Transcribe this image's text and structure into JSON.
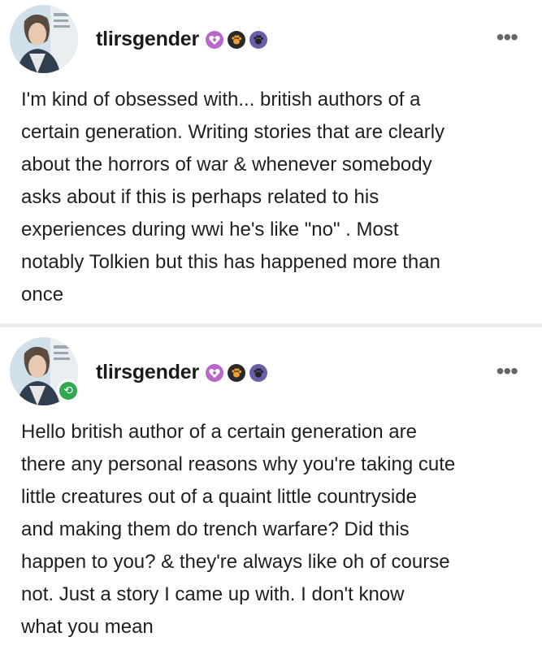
{
  "posts": [
    {
      "username": "tlirsgender",
      "more_icon": "more-horizontal-icon",
      "badges": [
        "sparkle-heart-badge-icon",
        "paw-badge-icon",
        "paw-badge-icon"
      ],
      "lines": [
        "I'm kind of obsessed with... british authors of a",
        "certain generation. Writing stories that are clearly",
        "about the horrors of war & whenever somebody",
        "asks about if this is perhaps related to his",
        "experiences during wwi he's like \"no\" . Most",
        "notably Tolkien but this has happened more than",
        "once"
      ]
    },
    {
      "username": "tlirsgender",
      "more_icon": "more-horizontal-icon",
      "reblog_icon": "reblog-icon",
      "badges": [
        "sparkle-heart-badge-icon",
        "paw-badge-icon",
        "paw-badge-icon"
      ],
      "lines": [
        "Hello british author of a certain generation are",
        "there any personal reasons why you're taking cute",
        "little creatures out of a quaint little countryside",
        "and making them do trench warfare? Did this",
        "happen to you? & they're always like oh of course",
        "not. Just a story I came up with. I don't know",
        "what you mean"
      ]
    }
  ],
  "colors": {
    "reblog_green": "#2fa84f",
    "badge_purple": "#b968c9",
    "badge_dark": "#2a2a2a",
    "badge_violet": "#6a5ea8",
    "divider": "#ececec"
  }
}
